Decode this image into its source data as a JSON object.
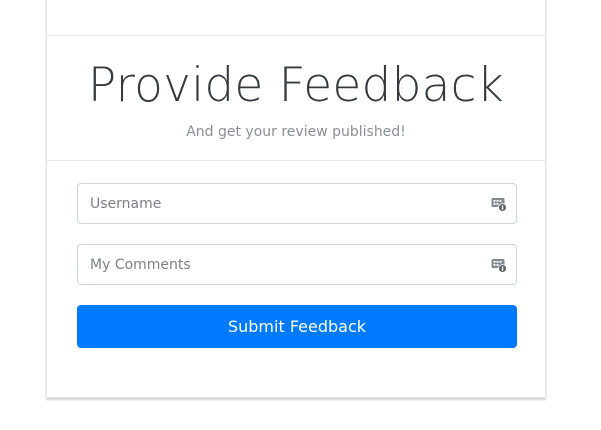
{
  "header": {
    "title": "Provide Feedback",
    "subtitle": "And get your review published!"
  },
  "form": {
    "username": {
      "placeholder": "Username",
      "value": "",
      "icon": "password-manager-icon"
    },
    "comments": {
      "placeholder": "My Comments",
      "value": "",
      "icon": "password-manager-icon"
    },
    "submit_label": "Submit Feedback"
  },
  "colors": {
    "accent": "#007bff",
    "title": "#343a40",
    "subtitle": "#8a8f95",
    "border": "#ced4da"
  }
}
